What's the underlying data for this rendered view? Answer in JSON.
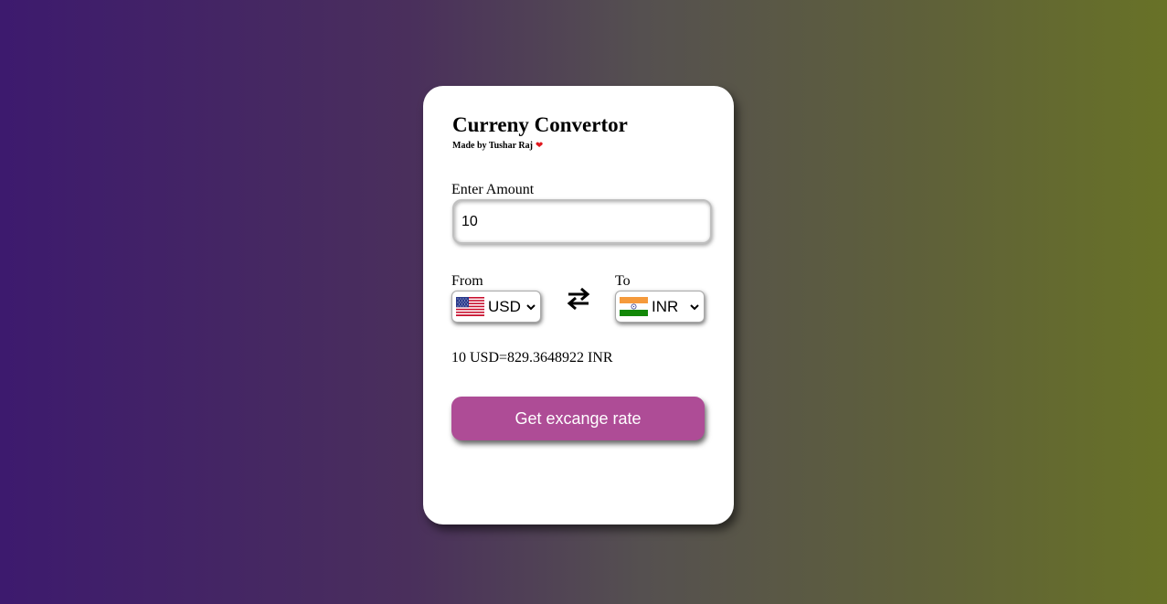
{
  "app": {
    "title": "Curreny Convertor",
    "subtitle": "Made by Tushar Raj",
    "heart": "❤"
  },
  "amount": {
    "label": "Enter Amount",
    "value": "10"
  },
  "from": {
    "label": "From",
    "currency": "USD",
    "flag_icon": "us-flag-icon"
  },
  "to": {
    "label": "To",
    "currency": "INR",
    "flag_icon": "india-flag-icon"
  },
  "swap_icon": "swap-arrows-icon",
  "result": {
    "text": "10 USD=829.3648922 INR"
  },
  "button": {
    "label": "Get excange rate"
  },
  "colors": {
    "button_bg": "#ae4c96",
    "card_bg": "#ffffff",
    "bg_left": "#3d1a6e",
    "bg_right": "#687227"
  }
}
